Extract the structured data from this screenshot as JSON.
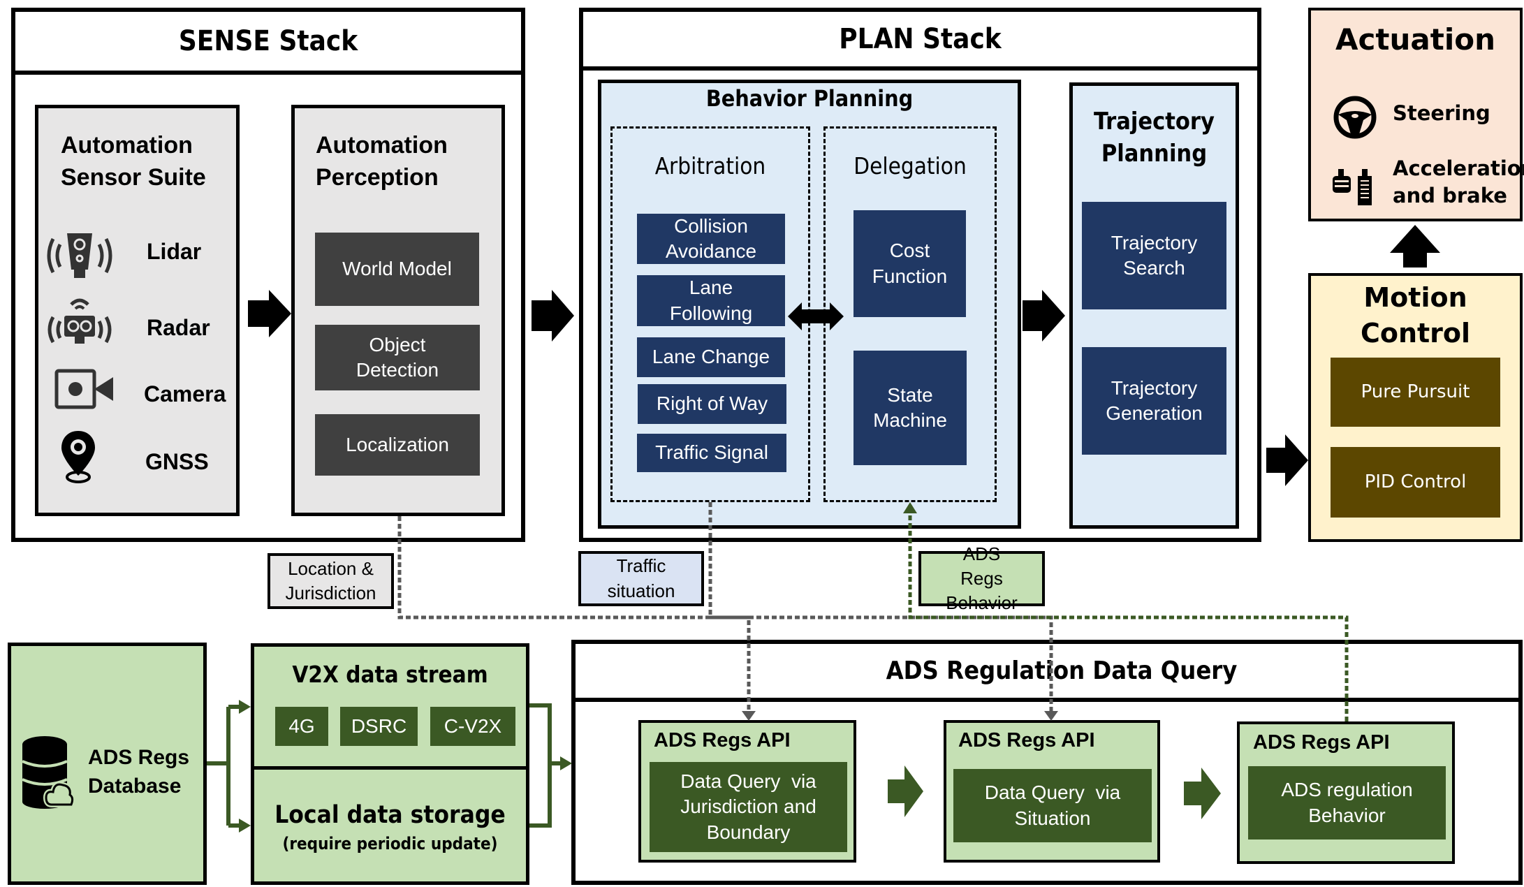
{
  "sense": {
    "title": "SENSE Stack",
    "sensor_suite": {
      "title_line1": "Automation",
      "title_line2": "Sensor Suite",
      "sensors": [
        {
          "label": "Lidar",
          "icon": "lidar-icon"
        },
        {
          "label": "Radar",
          "icon": "radar-icon"
        },
        {
          "label": "Camera",
          "icon": "camera-icon"
        },
        {
          "label": "GNSS",
          "icon": "gnss-pin-icon"
        }
      ]
    },
    "perception": {
      "title_line1": "Automation",
      "title_line2": "Perception",
      "modules": [
        "World Model",
        "Object Detection",
        "Localization"
      ]
    }
  },
  "plan": {
    "title": "PLAN Stack",
    "behavior": {
      "title": "Behavior Planning",
      "arbitration": {
        "title": "Arbitration",
        "items": [
          "Collision Avoidance",
          "Lane Following",
          "Lane Change",
          "Right of Way",
          "Traffic Signal"
        ]
      },
      "delegation": {
        "title": "Delegation",
        "items": [
          "Cost Function",
          "State Machine"
        ]
      }
    },
    "trajectory": {
      "title_line1": "Trajectory",
      "title_line2": "Planning",
      "items": [
        "Trajectory Search",
        "Trajectory Generation"
      ]
    }
  },
  "actuation": {
    "title": "Actuation",
    "items": [
      {
        "label": "Steering",
        "icon": "steering-wheel-icon"
      },
      {
        "label_line1": "Acceleration",
        "label_line2": "and brake",
        "icon": "pedals-icon"
      }
    ]
  },
  "motion_control": {
    "title_line1": "Motion",
    "title_line2": "Control",
    "items": [
      "Pure Pursuit",
      "PID Control"
    ]
  },
  "flow_labels": {
    "location": "Location & Jurisdiction",
    "traffic": "Traffic situation",
    "regs_behavior": "ADS Regs Behavior"
  },
  "database": {
    "line1": "ADS Regs",
    "line2": "Database",
    "icon": "cloud-database-icon"
  },
  "v2x": {
    "title": "V2X data stream",
    "chips": [
      "4G",
      "DSRC",
      "C-V2X"
    ]
  },
  "local_storage": {
    "title": "Local data storage",
    "subtitle": "(require periodic update)"
  },
  "query": {
    "title": "ADS Regulation Data Query",
    "apis": [
      {
        "title": "ADS Regs API",
        "body": "Data Query  via Jurisdiction and Boundary"
      },
      {
        "title": "ADS Regs API",
        "body": "Data Query  via Situation"
      },
      {
        "title": "ADS Regs API",
        "body": "ADS regulation Behavior"
      }
    ]
  },
  "colors": {
    "navy": "#203864",
    "dark_gray": "#404040",
    "brown": "#5c4700",
    "dark_green": "#3b5924",
    "light_green": "#c5e0b4",
    "light_blue": "#deebf7",
    "light_gray": "#e7e6e6",
    "peach": "#fbe5d6",
    "cream": "#fff2cc"
  }
}
